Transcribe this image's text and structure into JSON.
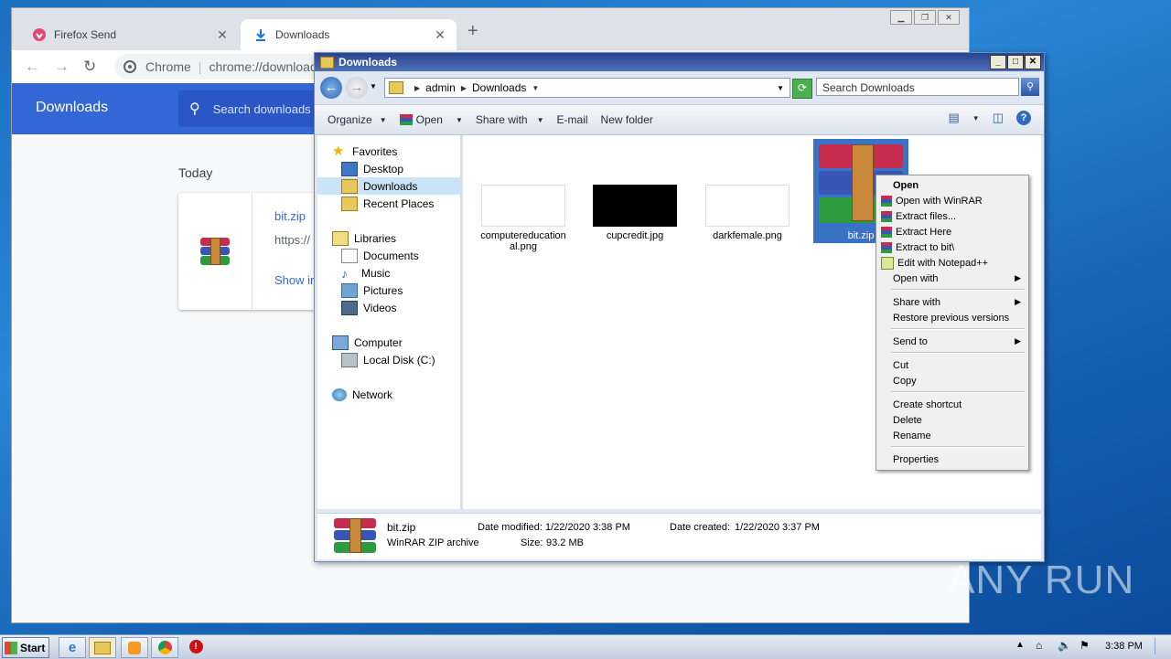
{
  "chrome": {
    "tabs": [
      {
        "label": "Firefox Send",
        "icon": "firefox-send-icon"
      },
      {
        "label": "Downloads",
        "icon": "download-icon"
      }
    ],
    "new_tab": "+",
    "address": {
      "site_label": "Chrome",
      "url": "chrome://downloads"
    },
    "downloads_page": {
      "title": "Downloads",
      "search_placeholder": "Search downloads",
      "section": "Today",
      "item": {
        "filename": "bit.zip",
        "url": "https://",
        "action": "Show in folder"
      }
    }
  },
  "explorer": {
    "title": "Downloads",
    "breadcrumb": [
      "admin",
      "Downloads"
    ],
    "search_placeholder": "Search Downloads",
    "toolbar": [
      "Organize",
      "Open",
      "Share with",
      "E-mail",
      "New folder"
    ],
    "nav": [
      {
        "label": "Favorites",
        "icon": "star-icon"
      },
      {
        "label": "Desktop",
        "icon": "desktop-icon"
      },
      {
        "label": "Downloads",
        "icon": "downloads-folder-icon",
        "selected": true
      },
      {
        "label": "Recent Places",
        "icon": "recent-places-icon"
      },
      {
        "label": "Libraries",
        "icon": "libraries-icon"
      },
      {
        "label": "Documents",
        "icon": "documents-icon"
      },
      {
        "label": "Music",
        "icon": "music-icon"
      },
      {
        "label": "Pictures",
        "icon": "pictures-icon"
      },
      {
        "label": "Videos",
        "icon": "videos-icon"
      },
      {
        "label": "Computer",
        "icon": "computer-icon"
      },
      {
        "label": "Local Disk (C:)",
        "icon": "disk-icon"
      },
      {
        "label": "Network",
        "icon": "network-icon"
      }
    ],
    "files": [
      {
        "name": "computereducation\nal.png"
      },
      {
        "name": "cupcredit.jpg"
      },
      {
        "name": "darkfemale.png"
      },
      {
        "name": "bit.zip",
        "selected": true
      }
    ],
    "status": {
      "name": "bit.zip",
      "type": "WinRAR ZIP archive",
      "modified_label": "Date modified:",
      "modified": "1/22/2020 3:38 PM",
      "created_label": "Date created:",
      "created": "1/22/2020 3:37 PM",
      "size_label": "Size:",
      "size": "93.2 MB"
    }
  },
  "context_menu": [
    {
      "label": "Open",
      "bold": true
    },
    {
      "label": "Open with WinRAR",
      "icon": "winrar-icon"
    },
    {
      "label": "Extract files...",
      "icon": "winrar-icon"
    },
    {
      "label": "Extract Here",
      "icon": "winrar-icon"
    },
    {
      "label": "Extract to bit\\",
      "icon": "winrar-icon"
    },
    {
      "label": "Edit with Notepad++",
      "icon": "notepadpp-icon"
    },
    {
      "label": "Open with",
      "submenu": true
    },
    {
      "label": "Share with",
      "submenu": true
    },
    {
      "label": "Restore previous versions"
    },
    {
      "label": "Send to",
      "submenu": true
    },
    {
      "label": "Cut"
    },
    {
      "label": "Copy"
    },
    {
      "label": "Create shortcut"
    },
    {
      "label": "Delete"
    },
    {
      "label": "Rename"
    },
    {
      "label": "Properties"
    }
  ],
  "taskbar": {
    "start": "Start",
    "clock": "3:38 PM"
  },
  "watermark": "ANY RUN"
}
